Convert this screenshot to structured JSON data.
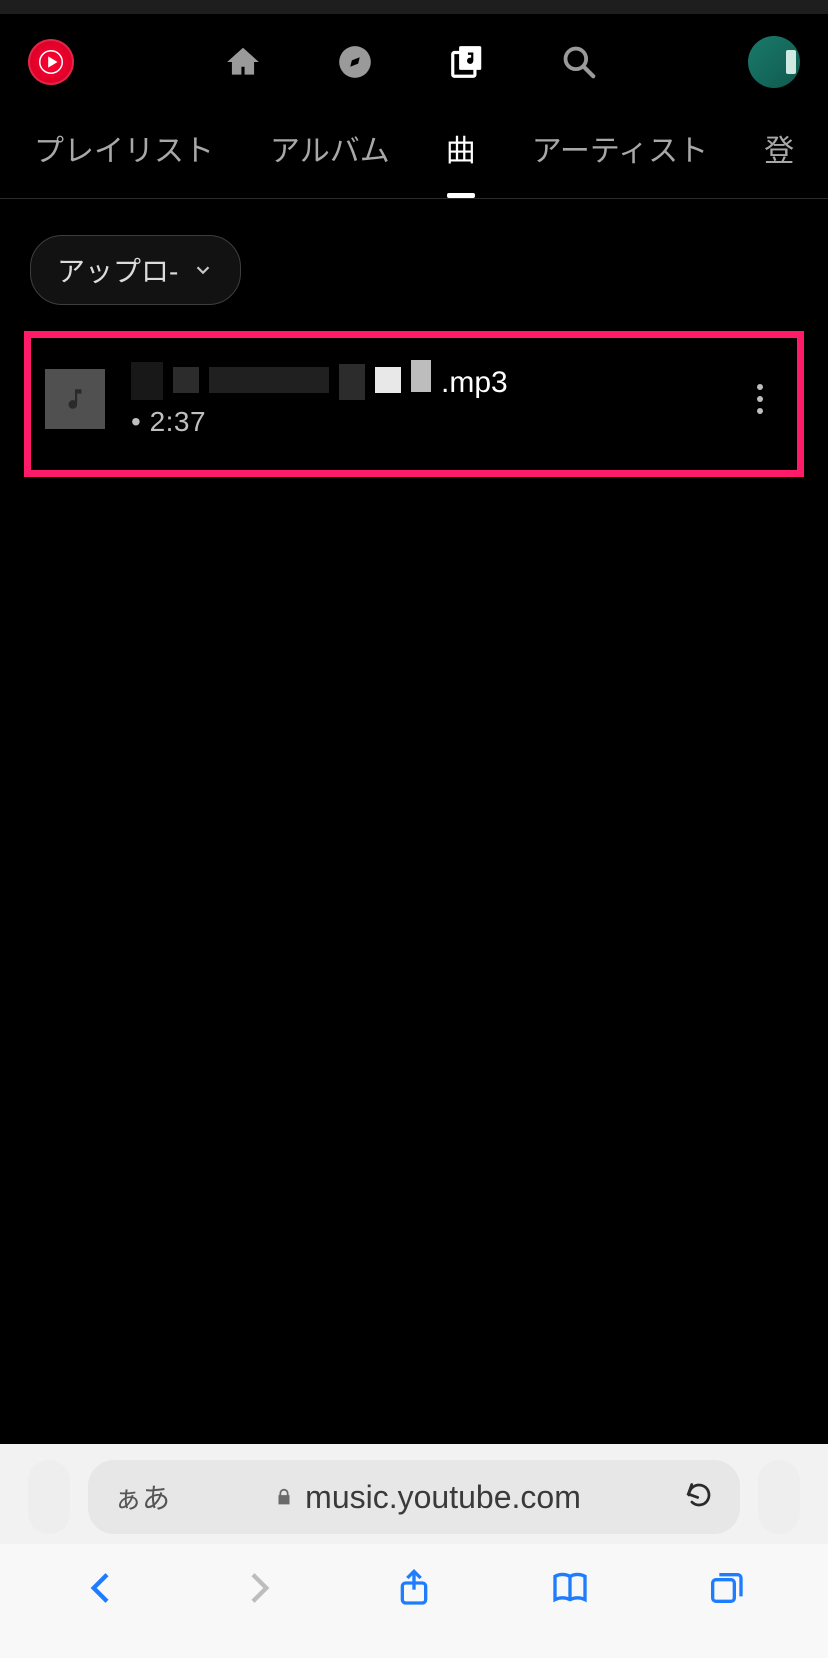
{
  "header": {
    "icons": {
      "logo": "youtube-music-logo",
      "home": "home-icon",
      "explore": "compass-icon",
      "library": "library-music-icon",
      "search": "search-icon",
      "avatar": "user-avatar"
    }
  },
  "tabs": {
    "items": [
      {
        "label": "プレイリスト",
        "active": false
      },
      {
        "label": "アルバム",
        "active": false
      },
      {
        "label": "曲",
        "active": true
      },
      {
        "label": "アーティスト",
        "active": false
      },
      {
        "label": "登",
        "active": false
      }
    ]
  },
  "filter_chip": {
    "label": "アップロ-"
  },
  "songs": [
    {
      "title_suffix": ".mp3",
      "subtitle": "• 2:37"
    }
  ],
  "browser": {
    "reader_btn": "ぁあ",
    "url_display": "music.youtube.com"
  }
}
